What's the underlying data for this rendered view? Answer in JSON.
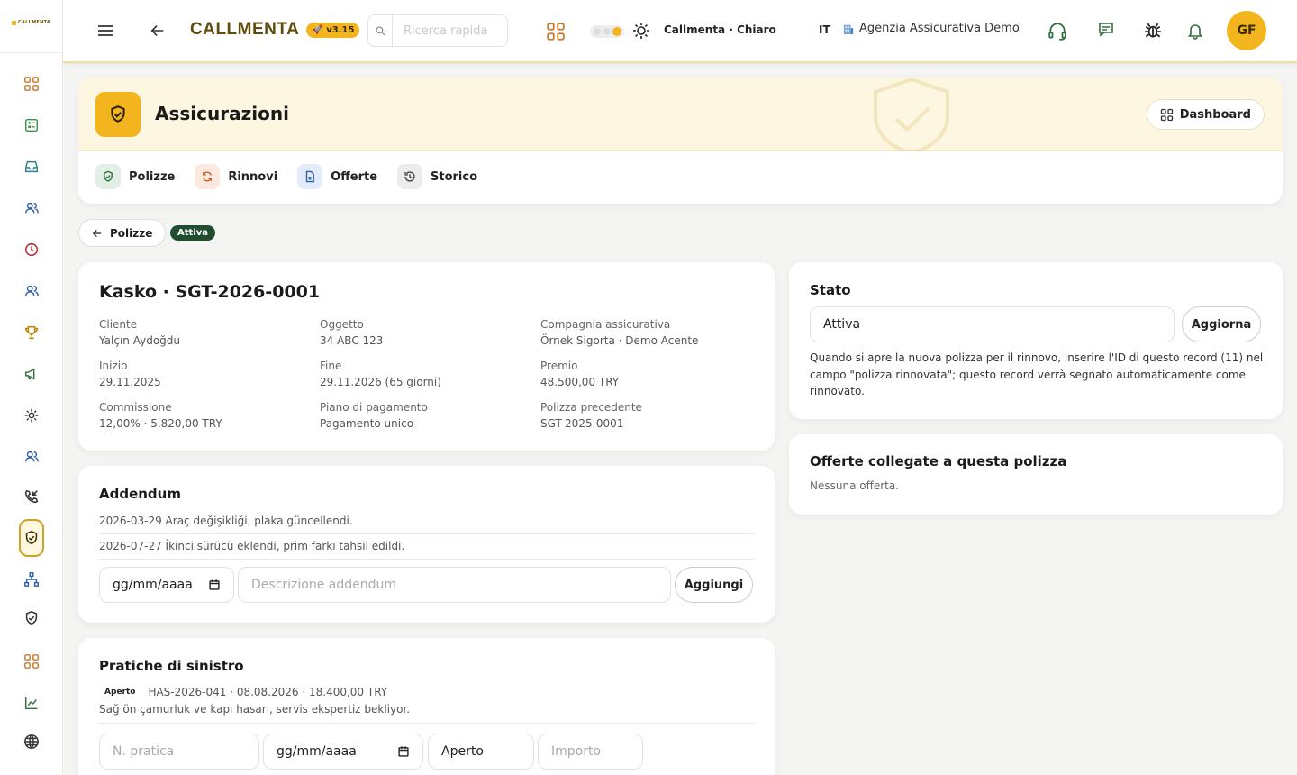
{
  "rail": {
    "logo": "CALLMENTA",
    "icons": [
      "grid-icon",
      "calculator-icon",
      "inbox-icon",
      "users-icon",
      "clock-icon",
      "team-icon",
      "trophy-icon",
      "megaphone-icon",
      "settings-icon",
      "contacts-icon",
      "phone-incoming-icon",
      "shield-check-icon",
      "org-chart-icon",
      "shield-icon",
      "apps-icon",
      "chart-line-icon",
      "globe-icon"
    ]
  },
  "topbar": {
    "brand": "CALLMENTA",
    "version": "v3.15",
    "search_placeholder": "Ricerca rapida",
    "theme_label": "Callmenta · Chiaro",
    "language": "IT",
    "agency": "Agenzia Assicurativa Demo",
    "avatar_initials": "GF"
  },
  "header": {
    "title": "Assicurazioni",
    "dashboard_label": "Dashboard",
    "tabs": [
      {
        "label": "Polizze",
        "icon": "shield-icon",
        "bg": "#e3efe6"
      },
      {
        "label": "Rinnovi",
        "icon": "refresh-icon",
        "bg": "#fbe9df"
      },
      {
        "label": "Offerte",
        "icon": "document-icon",
        "bg": "#e4ebfa"
      },
      {
        "label": "Storico",
        "icon": "history-icon",
        "bg": "#ececec"
      }
    ]
  },
  "breadcrumb": {
    "back_label": "Polizze",
    "status": "Attiva"
  },
  "policy": {
    "title": "Kasko · SGT-2026-0001",
    "fields": [
      {
        "label": "Cliente",
        "value": "Yalçın Aydoğdu"
      },
      {
        "label": "Oggetto",
        "value": "34 ABC 123"
      },
      {
        "label": "Compagnia assicurativa",
        "value": "Örnek Sigorta · Demo Acente"
      },
      {
        "label": "Inizio",
        "value": "29.11.2025"
      },
      {
        "label": "Fine",
        "value": "29.11.2026 (65 giorni)"
      },
      {
        "label": "Premio",
        "value": "48.500,00 TRY"
      },
      {
        "label": "Commissione",
        "value": "12,00% · 5.820,00 TRY"
      },
      {
        "label": "Piano di pagamento",
        "value": "Pagamento unico"
      },
      {
        "label": "Polizza precedente",
        "value": "SGT-2025-0001"
      }
    ]
  },
  "addendum": {
    "title": "Addendum",
    "rows": [
      "2026-03-29 Araç değişikliği, plaka güncellendi.",
      "2026-07-27 İkinci sürücü eklendi, prim farkı tahsil edildi."
    ],
    "date_placeholder": "gg/mm/aaaa",
    "desc_placeholder": "Descrizione addendum",
    "add_label": "Aggiungi"
  },
  "claims": {
    "title": "Pratiche di sinistro",
    "items": [
      {
        "status": "Aperto",
        "summary": "HAS-2026-041 · 08.08.2026 · 18.400,00 TRY",
        "description": "Sağ ön çamurluk ve kapı hasarı, servis ekspertiz bekliyor."
      }
    ],
    "number_placeholder": "N. pratica",
    "date_placeholder": "gg/mm/aaaa",
    "status_value": "Aperto",
    "amount_placeholder": "Importo"
  },
  "state": {
    "title": "Stato",
    "value": "Attiva",
    "update_label": "Aggiorna",
    "help": "Quando si apre la nuova polizza per il rinnovo, inserire l'ID di questo record (11) nel campo \"polizza rinnovata\"; questo record verrà segnato automaticamente come rinnovato."
  },
  "offers": {
    "title": "Offerte collegate a questa polizza",
    "empty": "Nessuna offerta."
  },
  "colors": {
    "accent": "#f2b51d",
    "brand": "#5e4d0e",
    "active_status": "#1f4d2e"
  }
}
